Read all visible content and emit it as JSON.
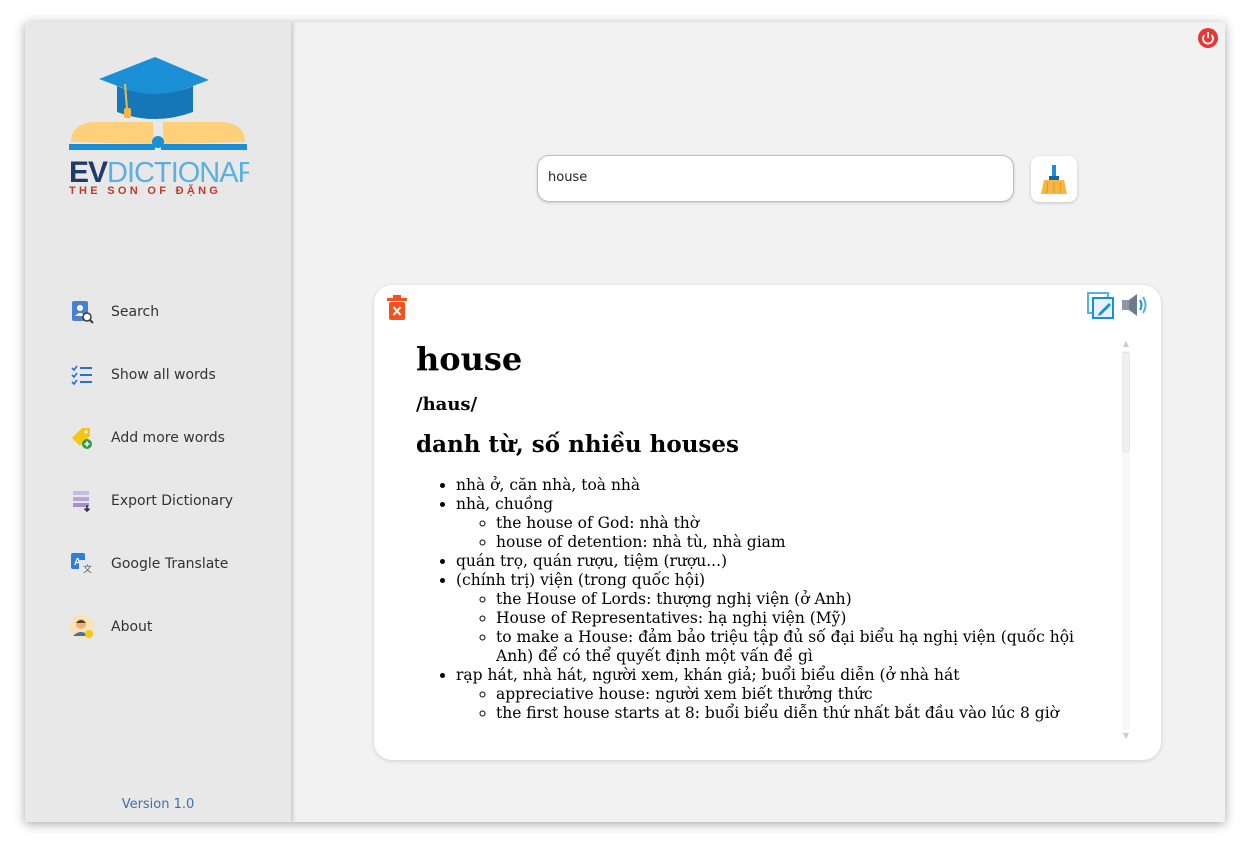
{
  "logo": {
    "brand": "EVDICTIONARY",
    "brand_ev": "EV",
    "brand_rest": "DICTIONARY",
    "tagline": "THE SON OF ĐẶNG"
  },
  "nav": {
    "items": [
      {
        "label": "Search",
        "icon": "search-person-icon"
      },
      {
        "label": "Show all words",
        "icon": "list-check-icon"
      },
      {
        "label": "Add more words",
        "icon": "tag-add-icon"
      },
      {
        "label": "Export Dictionary",
        "icon": "export-icon"
      },
      {
        "label": "Google Translate",
        "icon": "translate-icon"
      },
      {
        "label": "About",
        "icon": "user-avatar-icon"
      }
    ]
  },
  "version": "Version 1.0",
  "search": {
    "value": "house"
  },
  "colors": {
    "accent_blue": "#1a8fd6",
    "brand_red": "#c0392b",
    "power_red": "#e53935",
    "delete_orange": "#f4511e"
  },
  "entry": {
    "word": "house",
    "pronunciation": "/haus/",
    "part_of_speech": "danh từ, số nhiều houses",
    "senses": [
      {
        "text": "nhà ở, căn nhà, toà nhà",
        "examples": []
      },
      {
        "text": "nhà, chuồng",
        "examples": [
          "the house of God: nhà thờ",
          "house of detention: nhà tù, nhà giam"
        ]
      },
      {
        "text": "quán trọ, quán rượu, tiệm (rượu...)",
        "examples": []
      },
      {
        "text": "(chính trị) viện (trong quốc hội)",
        "examples": [
          "the House of Lords: thượng nghị viện (ở Anh)",
          "House of Representatives: hạ nghị viện (Mỹ)",
          "to make a House: đảm bảo triệu tập đủ số đại biểu hạ nghị viện (quốc hội Anh) để có thể quyết định một vấn đề gì"
        ]
      },
      {
        "text": "rạp hát, nhà hát, người xem, khán giả; buổi biểu diễn (ở nhà hát",
        "examples": [
          "appreciative house: người xem biết thưởng thức",
          "the first house starts at 8: buổi biểu diễn thứ nhất bắt đầu vào lúc 8 giờ"
        ]
      }
    ]
  }
}
